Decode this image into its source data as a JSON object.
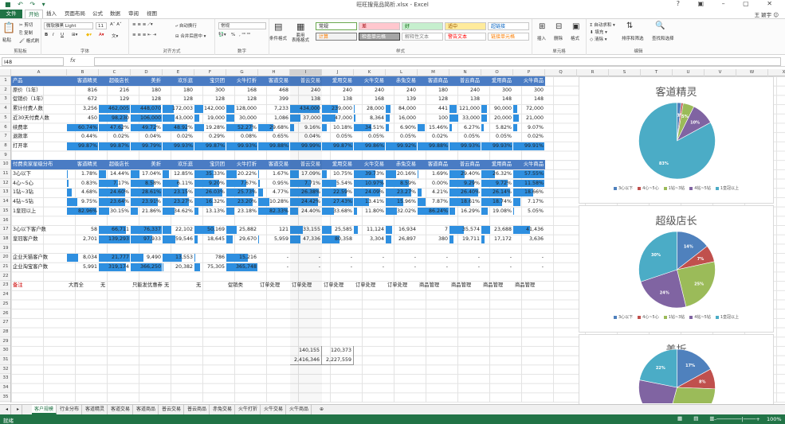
{
  "window": {
    "title": "旺旺搜竞品简析.xlsx - Excel",
    "user": "王 颖宇"
  },
  "tabs": [
    "文件",
    "开始",
    "插入",
    "页面布局",
    "公式",
    "数据",
    "审阅",
    "视图"
  ],
  "ribbon": {
    "clipboard": {
      "label": "剪贴板",
      "paste": "粘贴",
      "cut": "剪切",
      "copy": "复制",
      "painter": "格式刷"
    },
    "font": {
      "label": "字体",
      "name": "微软雅黑 Light",
      "size": "11",
      "bold": "B",
      "italic": "I",
      "underline": "U"
    },
    "align": {
      "label": "对齐方式",
      "wrap": "自动换行",
      "merge": "合并后居中"
    },
    "number": {
      "label": "数字",
      "format": "常规",
      "percent": "%"
    },
    "styles": {
      "label": "样式",
      "cond": "条件格式",
      "table": "套用\n表格格式",
      "cells": [
        {
          "t": "常规",
          "bg": "#ffffff",
          "fg": "#222",
          "bd": "#6aa84f"
        },
        {
          "t": "差",
          "bg": "#ffc7ce",
          "fg": "#9c0006",
          "bd": "#c8c8c8"
        },
        {
          "t": "好",
          "bg": "#c6efce",
          "fg": "#006100",
          "bd": "#c8c8c8"
        },
        {
          "t": "适中",
          "bg": "#ffeb9c",
          "fg": "#9c5700",
          "bd": "#c8c8c8"
        },
        {
          "t": "超链接",
          "bg": "#ffffff",
          "fg": "#0563c1",
          "bd": "#c8c8c8"
        },
        {
          "t": "计算",
          "bg": "#f2f2f2",
          "fg": "#fa7d00",
          "bd": "#7f7f7f"
        },
        {
          "t": "检查单元格",
          "bg": "#a5a5a5",
          "fg": "#ffffff",
          "bd": "#3f3f3f"
        },
        {
          "t": "解释性文本",
          "bg": "#ffffff",
          "fg": "#7f7f7f",
          "bd": "#c8c8c8"
        },
        {
          "t": "警告文本",
          "bg": "#ffffff",
          "fg": "#ff0000",
          "bd": "#c8c8c8"
        },
        {
          "t": "链接单元格",
          "bg": "#ffffff",
          "fg": "#fa7d00",
          "bd": "#c8c8c8"
        }
      ]
    },
    "cells": {
      "label": "单元格",
      "insert": "插入",
      "delete": "删除",
      "format": "格式"
    },
    "edit": {
      "label": "编辑",
      "autosum": "自动求和",
      "fill": "填充",
      "clear": "清除",
      "sort": "排序和筛选",
      "find": "查找和选择"
    }
  },
  "formula": {
    "namebox": "I48",
    "fx": "fx"
  },
  "columns": [
    "A",
    "B",
    "C",
    "D",
    "E",
    "F",
    "G",
    "H",
    "I",
    "J",
    "K",
    "L",
    "M",
    "N",
    "O",
    "P",
    "Q",
    "R",
    "S",
    "T",
    "U",
    "V",
    "W",
    "X"
  ],
  "rows": [
    "1",
    "2",
    "3",
    "4",
    "5",
    "6",
    "7",
    "8",
    "9",
    "10",
    "11",
    "12",
    "13",
    "14",
    "15",
    "16",
    "17",
    "18",
    "19",
    "20",
    "21",
    "22",
    "23",
    "24",
    "25",
    "26",
    "27",
    "28",
    "29",
    "30",
    "31",
    "32",
    "33",
    "34",
    "35"
  ],
  "table": {
    "r1": [
      "产品",
      "客道精灵",
      "超级店长",
      "美折",
      "欢乐逛",
      "宝贝团",
      "火牛打折",
      "客道交易",
      "普云交易",
      "爱用交易",
      "火牛交易",
      "赤兔交易",
      "客道商品",
      "普云商品",
      "爱用商品",
      "火牛商品"
    ],
    "r2": [
      "原价（1年）",
      "816",
      "216",
      "180",
      "180",
      "300",
      "168",
      "468",
      "240",
      "240",
      "240",
      "240",
      "180",
      "240",
      "300",
      "300"
    ],
    "r3": [
      "促销价（1年）",
      "672",
      "129",
      "128",
      "128",
      "128",
      "128",
      "399",
      "138",
      "138",
      "168",
      "139",
      "128",
      "138",
      "148",
      "148"
    ],
    "r4": [
      "累计付费人数",
      "3,256",
      "462,005",
      "448,070",
      "172,003",
      "142,000",
      "128,000",
      "7,233",
      "434,000",
      "239,000",
      "28,000",
      "84,000",
      "441",
      "121,000",
      "90,000",
      "72,000"
    ],
    "r5": [
      "近30天付费人数",
      "450",
      "98,230",
      "106,000",
      "43,000",
      "19,000",
      "30,000",
      "1,086",
      "37,000",
      "47,000",
      "8,364",
      "16,000",
      "100",
      "33,000",
      "20,000",
      "21,000"
    ],
    "r6": [
      "续费率",
      "60.74%",
      "47.62%",
      "49.72%",
      "48.92%",
      "19.28%",
      "52.27%",
      "29.68%",
      "9.16%",
      "10.18%",
      "34.51%",
      "6.90%",
      "15.46%",
      "6.27%",
      "5.82%",
      "9.07%"
    ],
    "r7": [
      "退款率",
      "0.44%",
      "0.02%",
      "0.04%",
      "0.02%",
      "0.29%",
      "0.08%",
      "0.65%",
      "0.04%",
      "0.05%",
      "0.05%",
      "0.05%",
      "0.02%",
      "0.05%",
      "0.05%",
      "0.02%"
    ],
    "r8": [
      "打开率",
      "99.87%",
      "99.87%",
      "99.79%",
      "99.93%",
      "99.87%",
      "99.93%",
      "99.88%",
      "99.99%",
      "99.87%",
      "99.86%",
      "99.92%",
      "99.88%",
      "99.93%",
      "99.93%",
      "99.91%"
    ],
    "r10": [
      "付费卖家星级分布",
      "客道精灵",
      "超级店长",
      "美折",
      "欢乐逛",
      "宝贝团",
      "火牛打折",
      "客道交易",
      "普云交易",
      "爱用交易",
      "火牛交易",
      "赤兔交易",
      "客道商品",
      "普云商品",
      "爱用商品",
      "火牛商品"
    ],
    "r11": [
      "3心以下",
      "1.78%",
      "14.44%",
      "17.04%",
      "12.85%",
      "35.33%",
      "20.22%",
      "1.67%",
      "17.09%",
      "10.75%",
      "39.73%",
      "20.16%",
      "1.69%",
      "29.40%",
      "26.32%",
      "57.55%"
    ],
    "r12": [
      "4心~5心",
      "0.83%",
      "7.17%",
      "8.58%",
      "6.11%",
      "9.20%",
      "7.67%",
      "0.95%",
      "7.71%",
      "5.54%",
      "10.97%",
      "8.59%",
      "0.00%",
      "9.29%",
      "9.72%",
      "11.58%"
    ],
    "r13": [
      "1钻~3钻",
      "4.68%",
      "24.60%",
      "28.61%",
      "23.15%",
      "26.03%",
      "25.73%",
      "4.77%",
      "26.38%",
      "22.59%",
      "24.09%",
      "23.27%",
      "4.21%",
      "26.40%",
      "26.14%",
      "18.66%"
    ],
    "r14": [
      "4钻~5钻",
      "9.75%",
      "23.64%",
      "23.91%",
      "23.27%",
      "16.32%",
      "23.20%",
      "10.28%",
      "24.42%",
      "27.43%",
      "13.41%",
      "15.96%",
      "7.87%",
      "18.61%",
      "18.74%",
      "7.17%"
    ],
    "r15": [
      "1皇冠以上",
      "82.96%",
      "30.15%",
      "21.86%",
      "34.62%",
      "13.13%",
      "23.18%",
      "82.33%",
      "24.40%",
      "33.68%",
      "11.80%",
      "32.02%",
      "86.24%",
      "16.29%",
      "19.08%",
      "5.05%"
    ],
    "r17": [
      "3心以下客户数",
      "58",
      "66,711",
      "76,337",
      "22,102",
      "50,169",
      "25,882",
      "121",
      "33,155",
      "25,585",
      "11,124",
      "16,934",
      "7",
      "35,574",
      "23,688",
      "41,436"
    ],
    "r18": [
      "皇冠客户数",
      "2,701",
      "139,293",
      "97,933",
      "59,546",
      "18,645",
      "29,670",
      "5,959",
      "47,336",
      "80,358",
      "3,304",
      "26,897",
      "380",
      "19,711",
      "17,172",
      "3,636"
    ],
    "r20": [
      "企业天猫客户数",
      "8,034",
      "21,777",
      "9,490",
      "13,553",
      "786",
      "15,216",
      "-",
      "-",
      "-",
      "-",
      "-",
      "-",
      "-",
      "-",
      "-"
    ],
    "r21": [
      "企业淘宝客户数",
      "5,991",
      "319,174",
      "366,250",
      "20,382",
      "75,305",
      "365,748",
      "-",
      "-",
      "-",
      "-",
      "-",
      "-",
      "-",
      "-",
      "-"
    ],
    "r23": [
      "备注",
      "大而全",
      "无",
      "只能发优惠券",
      "无",
      "无",
      "促销类",
      "订单处理",
      "订单处理",
      "订单处理",
      "订单处理",
      "订单处理",
      "商品管理",
      "商品管理",
      "商品管理",
      "商品管理"
    ],
    "r30": [
      "140,155",
      "120,373"
    ],
    "r31": [
      "2,416,346",
      "2,227,559"
    ]
  },
  "charts": [
    {
      "title": "客道精灵",
      "legend": [
        "3心以下",
        "4心~5心",
        "1钻~3钻",
        "4钻~5钻",
        "1皇冠以上"
      ],
      "labels": [
        "2%",
        "1%",
        "5%",
        "10%",
        "83%"
      ],
      "values": [
        1.78,
        0.83,
        4.68,
        9.75,
        82.96
      ]
    },
    {
      "title": "超级店长",
      "legend": [
        "3心以下",
        "4心~5心",
        "1钻~3钻",
        "4钻~5钻",
        "1皇冠以上"
      ],
      "labels": [
        "14%",
        "7%",
        "25%",
        "24%",
        "30%"
      ],
      "values": [
        14.44,
        7.17,
        24.6,
        23.64,
        30.15
      ]
    },
    {
      "title": "美折",
      "labels": [
        "17%",
        "8%",
        "",
        "",
        "22%"
      ],
      "values": [
        17.04,
        8.58,
        28.61,
        23.91,
        21.86
      ]
    }
  ],
  "chart_colors": [
    "#4f81bd",
    "#c0504d",
    "#9bbb59",
    "#8064a2",
    "#4bacc6"
  ],
  "sheets": [
    "客户规模",
    "行业分布",
    "客道精灵",
    "客道交易",
    "客道商品",
    "普云交易",
    "普云商品",
    "赤兔交易",
    "火牛打折",
    "火牛交易",
    "火牛商品"
  ],
  "status": {
    "mode": "就绪",
    "zoom": "100%"
  }
}
